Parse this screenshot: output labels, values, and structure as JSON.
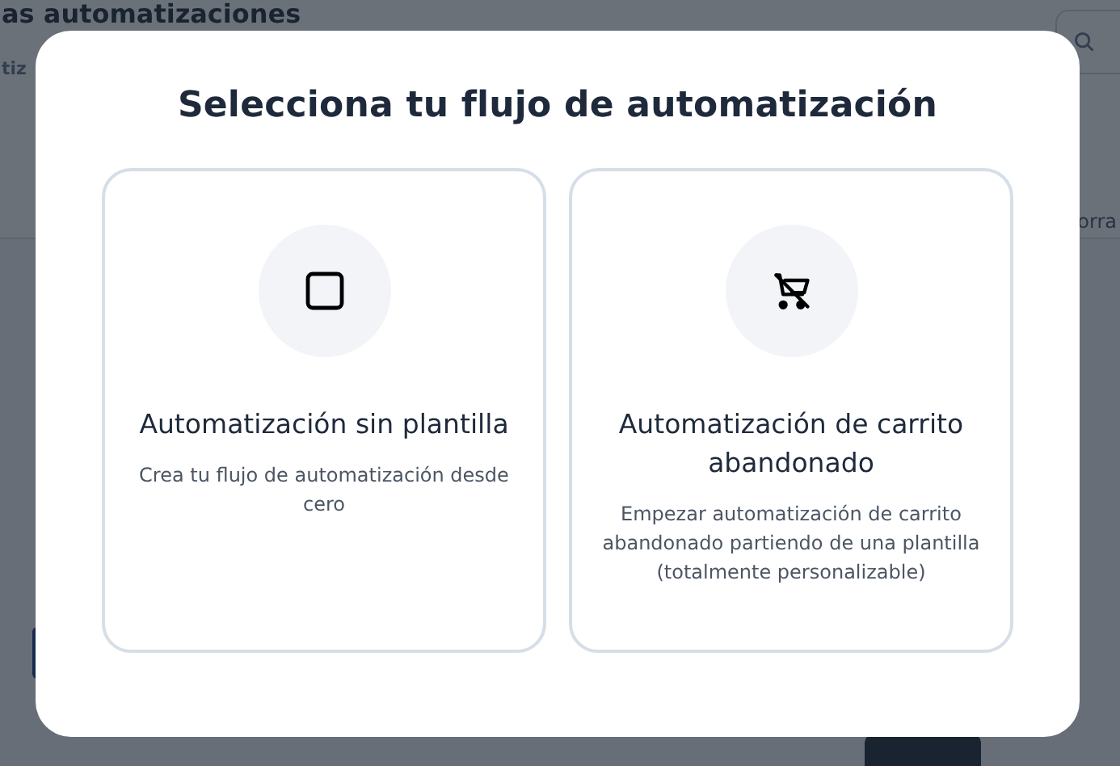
{
  "background": {
    "title": "as automatizaciones",
    "subtitle": "tiz",
    "tab_text": "orra"
  },
  "modal": {
    "title": "Selecciona tu flujo de automatización",
    "cards": [
      {
        "kind": "blank",
        "title": "Automatización sin plantilla",
        "description": "Crea tu flujo de automatización desde cero"
      },
      {
        "kind": "cart",
        "title": "Automatización de carrito abandonado",
        "description": "Empezar automatización de carrito abandonado partiendo de una plantilla (totalmente personalizable)"
      }
    ]
  }
}
